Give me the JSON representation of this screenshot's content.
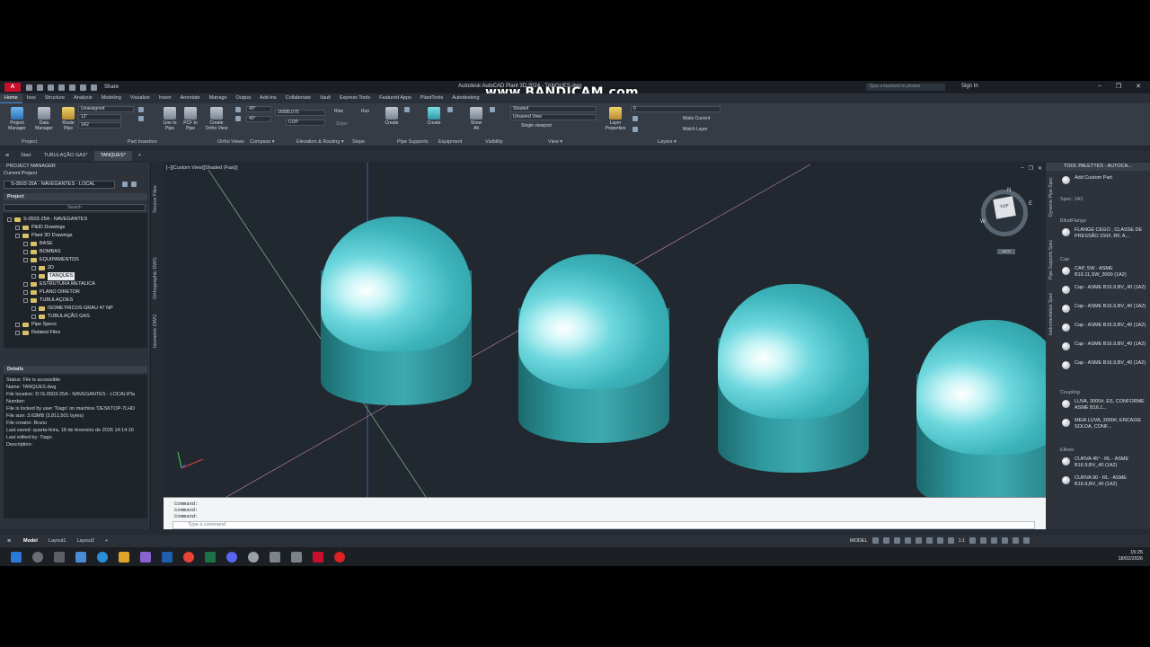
{
  "titlebar": {
    "share": "Share",
    "title": "Autodesk AutoCAD Plant 3D 2024 - TANQUES.dwg",
    "watermark": "www.BANDICAM.com",
    "search_placeholder": "Type a keyword or phrase",
    "signin": "Sign In"
  },
  "ribbon_tabs": [
    "Home",
    "Isos",
    "Structure",
    "Analysis",
    "Modeling",
    "Visualize",
    "Insert",
    "Annotate",
    "Manage",
    "Output",
    "Add-ins",
    "Collaborate",
    "Vault",
    "Express Tools",
    "Featured Apps",
    "PlantTools",
    "Autodesking"
  ],
  "ribbon": {
    "project_manager": "Project\nManager",
    "data_manager": "Data\nManager",
    "route_pipe": "Route\nPipe",
    "line_to_pipe": "Line to\nPipe",
    "pcf_to_pipe": "PCF to\nPipe",
    "create_ortho": "Create\nOrtho View",
    "sel_unassigned": "Unassigned",
    "sel_size": "12\"",
    "sel_spec": "1A2",
    "angle1": "45°",
    "angle2": "45°",
    "elev": "16585.075",
    "cop": "COP",
    "rise": "Rise",
    "run": "Run",
    "slope": "Slope",
    "create1": "Create",
    "create2": "Create",
    "show_all": "Show\nAll",
    "visual_style": "Shaded",
    "view": "Unsaved View",
    "viewport": "Single viewport",
    "layer_props": "Layer\nProperties",
    "layer_val": "0",
    "make_current": "Make Current",
    "match_layer": "Match Layer",
    "panels": [
      "Project",
      "Part Insertion",
      "Ortho Views",
      "Compass ▾",
      "Elevation & Routing ▾",
      "Slope",
      "Pipe Supports",
      "Equipment",
      "Visibility",
      "View ▾",
      "Layers ▾"
    ]
  },
  "doc_tabs": [
    "Start",
    "TUBULAÇÃO GAS*",
    "TANQUES*",
    "+"
  ],
  "project_manager": {
    "title": "PROJECT MANAGER",
    "current_project_label": "Current Project",
    "current_project": "S-0503-25A - NAVEGANTES - LOCAL",
    "project_header": "Project",
    "search": "Search",
    "tree": [
      {
        "label": "S-0503-25A - NAVEGANTES",
        "indent": 0
      },
      {
        "label": "P&ID Drawings",
        "indent": 1
      },
      {
        "label": "Plant 3D Drawings",
        "indent": 1
      },
      {
        "label": "BASE",
        "indent": 2
      },
      {
        "label": "BOMBAS",
        "indent": 2
      },
      {
        "label": "EQUIPAMENTOS",
        "indent": 2
      },
      {
        "label": "2D",
        "indent": 3
      },
      {
        "label": "TANQUES",
        "indent": 3,
        "selected": true
      },
      {
        "label": "ESTRUTURA METALICA",
        "indent": 2
      },
      {
        "label": "PLANO DIRETOR",
        "indent": 2
      },
      {
        "label": "TUBULAÇOES",
        "indent": 2
      },
      {
        "label": "ISOMETRICOS GRAU 47 NP",
        "indent": 3
      },
      {
        "label": "TUBULAÇÃO GAS",
        "indent": 3
      },
      {
        "label": "Pipe Specs",
        "indent": 1
      },
      {
        "label": "Related Files",
        "indent": 1
      }
    ],
    "details_header": "Details",
    "details": [
      "Status: File is accessible",
      "Name: TANQUES.dwg",
      "File location: D:\\S-0503-25A - NAVEGANTES - LOCAL\\Pla",
      "Number:",
      "File is locked by user 'Tiago' on machine 'DESKTOP-7LHD",
      "File size: 3.63MB (3,811,501 bytes)",
      "File creator: Bruno",
      "Last saved: quarta-feira, 18 de fevereiro de 2026 14:14:16",
      "Last edited by: Tiago",
      "Description:"
    ],
    "side_tabs": [
      "Source Files",
      "Orthographic DWG",
      "Isometric DWG"
    ]
  },
  "viewport": {
    "label": "[−][Custom View][Shaded (Fast)]",
    "cube_top": "TOP",
    "n": "N",
    "w": "W",
    "e": "E",
    "wcs": "WCS"
  },
  "command": {
    "history": [
      "Command:",
      "Command:",
      "Command:"
    ],
    "placeholder": "Type a command"
  },
  "tool_palette": {
    "title": "TOOL PALETTES - AUTOCA...",
    "side_tabs": [
      "Dynamic Pipe Spec",
      "Pipe Supports Spec",
      "Instrumentation Spec"
    ],
    "add_custom": "Add Custom Part",
    "spec": "Spec: 1A2",
    "sections": [
      {
        "title": "BlindFlange",
        "items": [
          "FLANGE CEGO , CLASSE DE PRESSÃO 150#, RF, A..."
        ]
      },
      {
        "title": "Cap",
        "items": [
          "CAP, SW - ASME B16.11,SW_3000 (1A2)",
          "Cap - ASME B16.9,BV_40 (1A2)",
          "Cap - ASME B16.9,BV_40 (1A2)",
          "Cap - ASME B16.9,BV_40 (1A2)",
          "Cap - ASME B16.9,BV_40 (1A2)",
          "Cap - ASME B16.9,BV_40 (1A2)"
        ]
      },
      {
        "title": "Coupling",
        "items": [
          "LUVA, 3000#, ES, CONFORME ASME B16.1...",
          "MEIA LUVA, 3000#, ENCAIXE SOLDA, CONF..."
        ]
      },
      {
        "title": "Elbow",
        "items": [
          "CURVA 45° - RL - ASME B16.9,BV_40 (1A2)",
          "CURVA 90 - RL - ASME B16.9,BV_40 (1A2)"
        ]
      }
    ]
  },
  "status": {
    "tabs": [
      "Model",
      "Layout1",
      "Layout2",
      "+"
    ],
    "model": "MODEL",
    "scale": "1:1"
  },
  "taskbar": {
    "time": "15:25",
    "date": "18/02/2026"
  },
  "colors": {
    "accent": "#3d8de0",
    "tank": "#3caab0",
    "bg": "#212830"
  }
}
